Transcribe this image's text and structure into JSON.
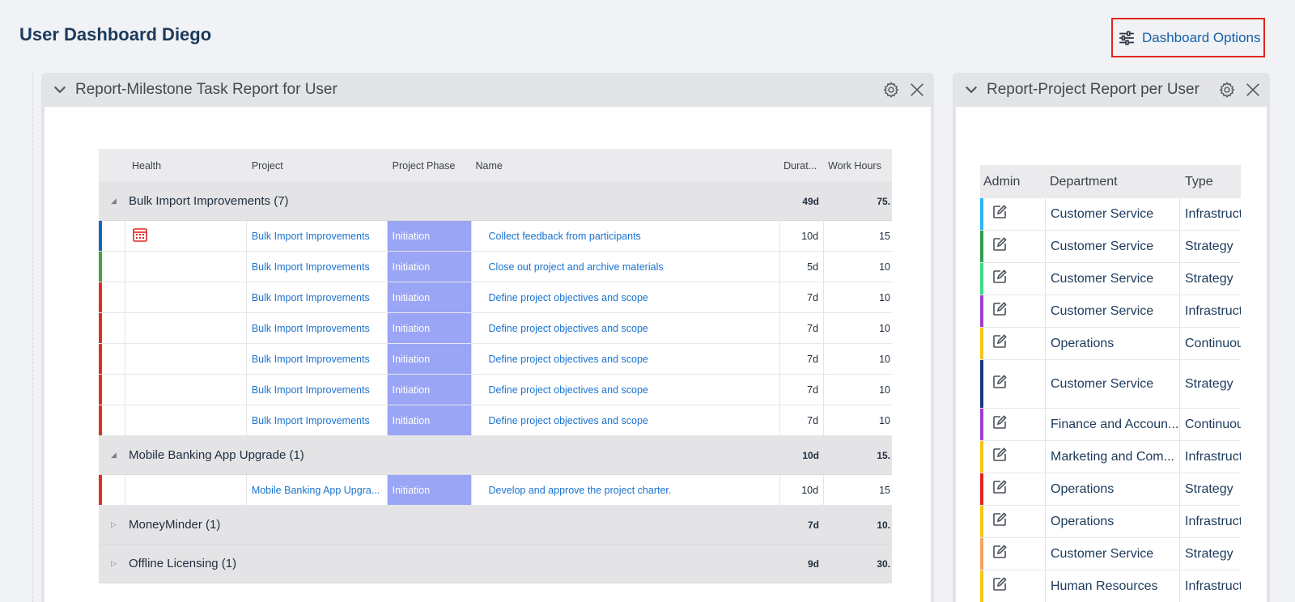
{
  "page_title": "User Dashboard Diego",
  "dashboard_options_label": "Dashboard Options",
  "widget_milestone": {
    "title": "Report-Milestone Task Report for User",
    "columns": {
      "health": "Health",
      "project": "Project",
      "phase": "Project Phase",
      "name": "Name",
      "duration": "Durat...",
      "work_hours": "Work Hours"
    },
    "groups": [
      {
        "label": "Bulk Import Improvements (7)",
        "expanded": true,
        "duration": "49d",
        "work_hours": "75.",
        "rows": [
          {
            "bar": "#1565c0",
            "health_icon": "calendar-icon",
            "project": "Bulk Import Improvements",
            "phase": "Initiation",
            "name": "Collect feedback from participants",
            "duration": "10d",
            "work_hours": "15"
          },
          {
            "bar": "#43a047",
            "health_icon": "",
            "project": "Bulk Import Improvements",
            "phase": "Initiation",
            "name": "Close out project and archive materials",
            "duration": "5d",
            "work_hours": "10"
          },
          {
            "bar": "#d9331f",
            "health_icon": "",
            "project": "Bulk Import Improvements",
            "phase": "Initiation",
            "name": "Define project objectives and scope",
            "duration": "7d",
            "work_hours": "10"
          },
          {
            "bar": "#d9331f",
            "health_icon": "",
            "project": "Bulk Import Improvements",
            "phase": "Initiation",
            "name": "Define project objectives and scope",
            "duration": "7d",
            "work_hours": "10"
          },
          {
            "bar": "#d9331f",
            "health_icon": "",
            "project": "Bulk Import Improvements",
            "phase": "Initiation",
            "name": "Define project objectives and scope",
            "duration": "7d",
            "work_hours": "10"
          },
          {
            "bar": "#d9331f",
            "health_icon": "",
            "project": "Bulk Import Improvements",
            "phase": "Initiation",
            "name": "Define project objectives and scope",
            "duration": "7d",
            "work_hours": "10"
          },
          {
            "bar": "#d9331f",
            "health_icon": "",
            "project": "Bulk Import Improvements",
            "phase": "Initiation",
            "name": "Define project objectives and scope",
            "duration": "7d",
            "work_hours": "10"
          }
        ]
      },
      {
        "label": "Mobile Banking App Upgrade (1)",
        "expanded": true,
        "duration": "10d",
        "work_hours": "15.",
        "rows": [
          {
            "bar": "#d9331f",
            "health_icon": "",
            "project": "Mobile Banking App Upgra...",
            "phase": "Initiation",
            "name": "Develop and approve the project charter.",
            "duration": "10d",
            "work_hours": "15"
          }
        ]
      },
      {
        "label": "MoneyMinder (1)",
        "expanded": false,
        "duration": "7d",
        "work_hours": "10.",
        "rows": []
      },
      {
        "label": "Offline Licensing (1)",
        "expanded": false,
        "duration": "9d",
        "work_hours": "30.",
        "rows": []
      }
    ]
  },
  "widget_project": {
    "title": "Report-Project Report per User",
    "columns": {
      "admin": "Admin",
      "department": "Department",
      "type": "Type"
    },
    "rows": [
      {
        "bar": "#29b6f6",
        "department": "Customer Service",
        "type": "Infrastruct"
      },
      {
        "bar": "#2e9d4f",
        "department": "Customer Service",
        "type": "Strategy"
      },
      {
        "bar": "#3ddc84",
        "department": "Customer Service",
        "type": "Strategy"
      },
      {
        "bar": "#9c3fd1",
        "department": "Customer Service",
        "type": "Infrastruct"
      },
      {
        "bar": "#f5c518",
        "department": "Operations",
        "type": "Continuou"
      },
      {
        "bar": "#1b3a7a",
        "department": "Customer Service",
        "type": "Strategy",
        "tall": true
      },
      {
        "bar": "#9c3fd1",
        "department": "Finance and Accoun...",
        "type": "Continuou"
      },
      {
        "bar": "#f5c518",
        "department": "Marketing and Com...",
        "type": "Infrastruct"
      },
      {
        "bar": "#e0261f",
        "department": "Operations",
        "type": "Strategy"
      },
      {
        "bar": "#f5c518",
        "department": "Operations",
        "type": "Infrastruct"
      },
      {
        "bar": "#f4a460",
        "department": "Customer Service",
        "type": "Strategy"
      },
      {
        "bar": "#f5c518",
        "department": "Human Resources",
        "type": "Infrastruct"
      }
    ]
  },
  "colors": {
    "accent_link": "#1a73d1",
    "phase_fill": "#9aa5f5",
    "highlight_border": "#e0261f"
  }
}
